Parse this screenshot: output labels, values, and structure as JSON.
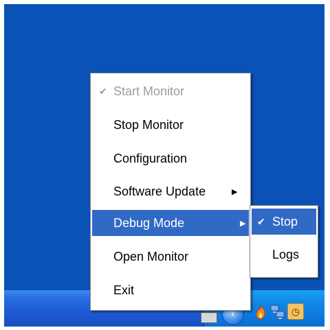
{
  "tray_menu": {
    "items": [
      {
        "label": "Start Monitor",
        "checked": true,
        "disabled": true
      },
      {
        "label": "Stop Monitor",
        "checked": false,
        "disabled": false
      },
      {
        "label": "Configuration",
        "checked": false,
        "disabled": false
      },
      {
        "label": "Software Update",
        "has_submenu": true
      },
      {
        "label": "Debug Mode",
        "has_submenu": true,
        "highlighted": true
      },
      {
        "label": "Open Monitor",
        "checked": false,
        "disabled": false
      },
      {
        "label": "Exit",
        "checked": false,
        "disabled": false
      }
    ],
    "check_glyph": "✔",
    "arrow_glyph": "▶"
  },
  "debug_submenu": {
    "items": [
      {
        "label": "Stop",
        "checked": true,
        "highlighted": true
      },
      {
        "label": "Logs",
        "checked": false
      }
    ]
  },
  "colors": {
    "desktop": "#0a52b5",
    "highlight": "#316ac5",
    "disabled_text": "#9c9c9c"
  },
  "tray": {
    "icons": [
      "keyboard-icon",
      "arrow-circle-icon",
      "fire-icon",
      "network-icon",
      "clock-icon"
    ]
  }
}
